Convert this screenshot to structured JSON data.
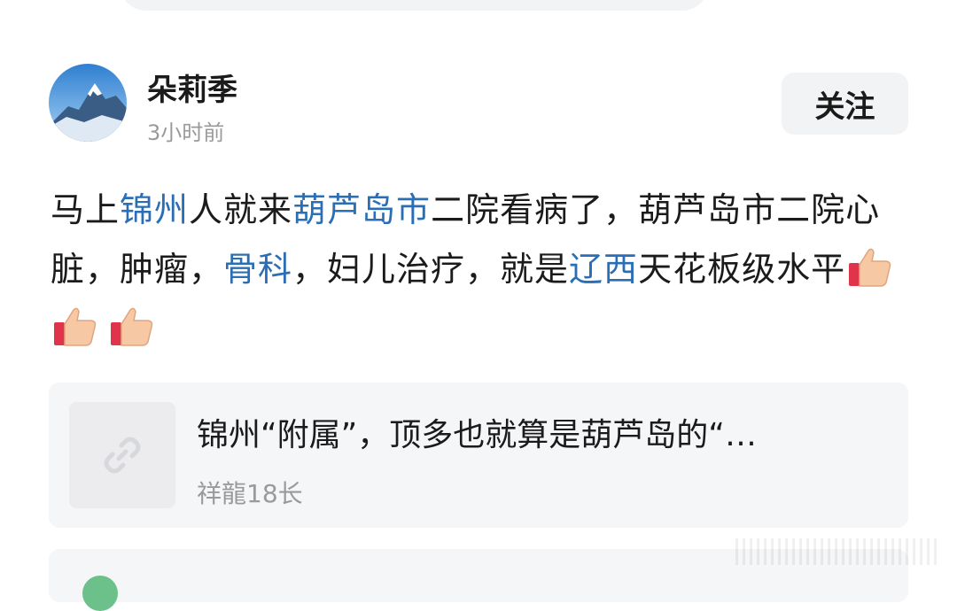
{
  "author": {
    "name": "朵莉季",
    "time": "3小时前"
  },
  "follow_label": "关注",
  "post": {
    "segments": [
      {
        "text": "马上",
        "link": false
      },
      {
        "text": "锦州",
        "link": true
      },
      {
        "text": "人就来",
        "link": false
      },
      {
        "text": "葫芦岛市",
        "link": true
      },
      {
        "text": "二院看病了，葫芦岛市二院心脏，肿瘤，",
        "link": false
      },
      {
        "text": "骨科",
        "link": true
      },
      {
        "text": "，妇儿治疗，就是",
        "link": false
      },
      {
        "text": "辽西",
        "link": true
      },
      {
        "text": "天花板级水平",
        "link": false
      }
    ],
    "emoji": [
      "thumbs-up-icon",
      "thumbs-up-icon",
      "thumbs-up-icon"
    ]
  },
  "link_card": {
    "title": "锦州“附属”，顶多也就算是葫芦岛的“…",
    "author": "祥龍18长",
    "icon": "link-icon"
  },
  "colors": {
    "link": "#2a6fb6",
    "card_bg": "#f5f6f8",
    "muted": "#9a9a9a"
  }
}
